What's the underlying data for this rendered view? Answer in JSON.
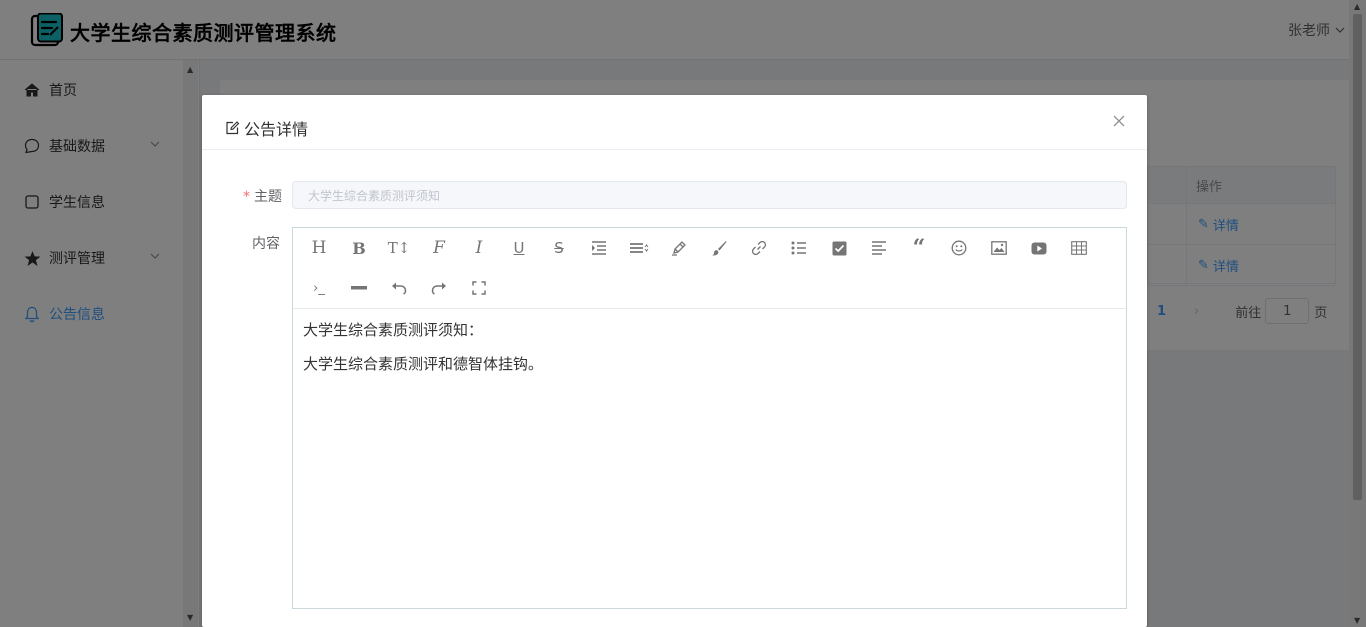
{
  "app": {
    "title": "大学生综合素质测评管理系统",
    "user": "张老师"
  },
  "sidebar": {
    "items": [
      {
        "label": "首页",
        "icon": "home-icon"
      },
      {
        "label": "基础数据",
        "icon": "chat-bubble-icon",
        "has_submenu": true
      },
      {
        "label": "学生信息",
        "icon": "square-icon"
      },
      {
        "label": "测评管理",
        "icon": "star-icon",
        "has_submenu": true
      },
      {
        "label": "公告信息",
        "icon": "bell-icon",
        "active": true
      }
    ]
  },
  "background_table": {
    "header": "操作",
    "rows": [
      {
        "action": "详情"
      },
      {
        "action": "详情"
      }
    ]
  },
  "pagination": {
    "current_page": "1",
    "goto_label": "前往",
    "goto_value": "1",
    "page_suffix": "页"
  },
  "dialog": {
    "title": "公告详情",
    "subject": {
      "label": "主题",
      "required": true,
      "value": "大学生综合素质测评须知"
    },
    "content": {
      "label": "内容",
      "paragraphs": [
        "大学生综合素质测评须知：",
        "大学生综合素质测评和德智体挂钩。"
      ]
    },
    "toolbar_icons": [
      "heading-icon",
      "bold-icon",
      "font-size-icon",
      "font-family-icon",
      "italic-icon",
      "underline-icon",
      "strikethrough-icon",
      "indent-icon",
      "line-height-icon",
      "highlight-pen-icon",
      "brush-icon",
      "link-icon",
      "unordered-list-icon",
      "checkbox-icon",
      "align-left-icon",
      "quote-icon",
      "emoji-icon",
      "image-icon",
      "video-icon",
      "table-icon",
      "code-icon",
      "horizontal-rule-icon",
      "undo-icon",
      "redo-icon",
      "fullscreen-icon"
    ]
  },
  "colors": {
    "accent": "#409eff",
    "required": "#f56c6c",
    "overlay": "rgba(0,0,0,0.5)"
  }
}
